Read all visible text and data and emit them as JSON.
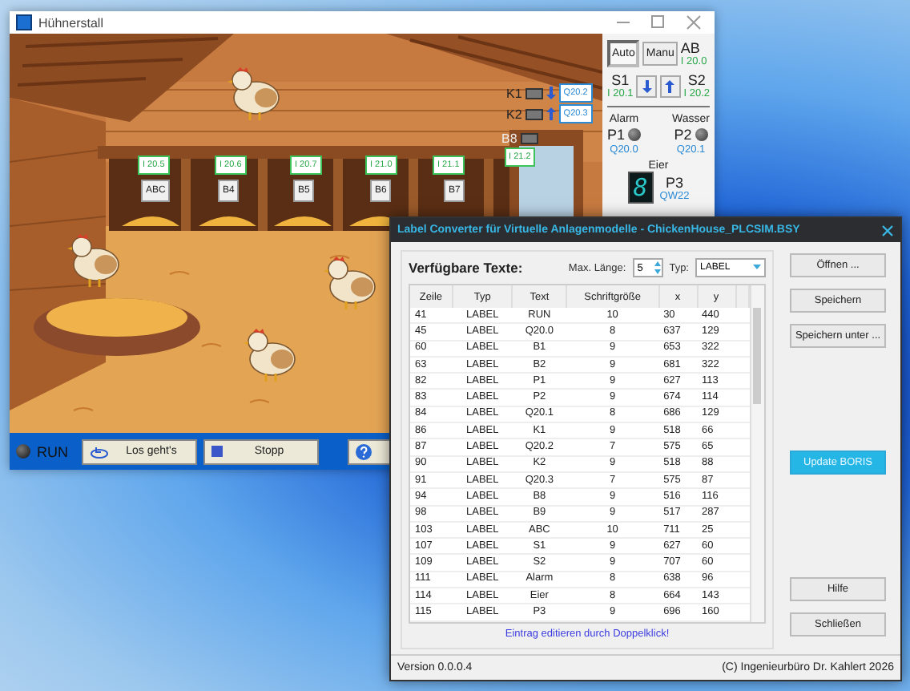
{
  "coop_window": {
    "title": "Hühnerstall",
    "scene": {
      "input_tags": [
        "I 20.5",
        "I 20.6",
        "I 20.7",
        "I 21.0",
        "I 21.1"
      ],
      "nest_buttons": [
        "ABC",
        "B4",
        "B5",
        "B6",
        "B7"
      ],
      "actuators": [
        {
          "label": "K1",
          "kind": "down",
          "address": "Q20.2"
        },
        {
          "label": "K2",
          "kind": "up",
          "address": "Q20.3"
        }
      ],
      "sensor": {
        "label": "B8",
        "address": "I 21.2"
      }
    },
    "panel": {
      "mode_buttons": [
        {
          "label": "Auto",
          "selected": true
        },
        {
          "label": "Manu",
          "selected": false
        }
      ],
      "corner_label": "AB",
      "corner_address": "I 20.0",
      "switches": [
        {
          "label": "S1",
          "address": "I 20.1"
        },
        {
          "label": "S2",
          "address": "I 20.2"
        }
      ],
      "jog_buttons": [
        {
          "kind": "down"
        },
        {
          "kind": "up"
        }
      ],
      "lamps": [
        {
          "caption": "Alarm",
          "label": "P1",
          "address": "Q20.0",
          "on": false
        },
        {
          "caption": "Wasser",
          "label": "P2",
          "address": "Q20.1",
          "on": false
        }
      ],
      "display": {
        "caption": "Eier",
        "value": "8",
        "label": "P3",
        "address": "QW22"
      }
    },
    "bottom_bar": {
      "run_lamp_on": false,
      "run_label": "RUN",
      "buttons": [
        {
          "kind": "start",
          "label": "Los geht's"
        },
        {
          "kind": "stop",
          "label": "Stopp"
        },
        {
          "kind": "help"
        }
      ]
    }
  },
  "converter_window": {
    "title": "Label Converter für Virtuelle Anlagenmodelle - ChickenHouse_PLCSIM.BSY",
    "heading": "Verfügbare Texte:",
    "max_length_label": "Max. Länge:",
    "max_length_value": "5",
    "type_label": "Typ:",
    "type_value": "LABEL",
    "table": {
      "columns": [
        "Zeile",
        "Typ",
        "Text",
        "Schriftgröße",
        "x",
        "y"
      ],
      "rows": [
        [
          "41",
          "LABEL",
          "RUN",
          "10",
          "30",
          "440"
        ],
        [
          "45",
          "LABEL",
          "Q20.0",
          "8",
          "637",
          "129"
        ],
        [
          "60",
          "LABEL",
          "B1",
          "9",
          "653",
          "322"
        ],
        [
          "63",
          "LABEL",
          "B2",
          "9",
          "681",
          "322"
        ],
        [
          "82",
          "LABEL",
          "P1",
          "9",
          "627",
          "113"
        ],
        [
          "83",
          "LABEL",
          "P2",
          "9",
          "674",
          "114"
        ],
        [
          "84",
          "LABEL",
          "Q20.1",
          "8",
          "686",
          "129"
        ],
        [
          "86",
          "LABEL",
          "K1",
          "9",
          "518",
          "66"
        ],
        [
          "87",
          "LABEL",
          "Q20.2",
          "7",
          "575",
          "65"
        ],
        [
          "90",
          "LABEL",
          "K2",
          "9",
          "518",
          "88"
        ],
        [
          "91",
          "LABEL",
          "Q20.3",
          "7",
          "575",
          "87"
        ],
        [
          "94",
          "LABEL",
          "B8",
          "9",
          "516",
          "116"
        ],
        [
          "98",
          "LABEL",
          "B9",
          "9",
          "517",
          "287"
        ],
        [
          "103",
          "LABEL",
          "ABC",
          "10",
          "711",
          "25"
        ],
        [
          "107",
          "LABEL",
          "S1",
          "9",
          "627",
          "60"
        ],
        [
          "109",
          "LABEL",
          "S2",
          "9",
          "707",
          "60"
        ],
        [
          "111",
          "LABEL",
          "Alarm",
          "8",
          "638",
          "96"
        ],
        [
          "114",
          "LABEL",
          "Eier",
          "8",
          "664",
          "143"
        ],
        [
          "115",
          "LABEL",
          "P3",
          "9",
          "696",
          "160"
        ]
      ]
    },
    "hint": "Eintrag editieren durch Doppelklick!",
    "button_groups": [
      [
        {
          "label": "Öffnen ...",
          "highlighted": false
        },
        {
          "label": "Speichern",
          "highlighted": false
        },
        {
          "label": "Speichern unter ...",
          "highlighted": false
        }
      ],
      [
        {
          "label": "Update BORIS",
          "highlighted": true
        }
      ],
      [
        {
          "label": "Hilfe",
          "highlighted": false
        },
        {
          "label": "Schließen",
          "highlighted": false
        }
      ]
    ],
    "status_left": "Version 0.0.0.4",
    "status_right": "(C) Ingenieurbüro Dr. Kahlert 2026"
  }
}
